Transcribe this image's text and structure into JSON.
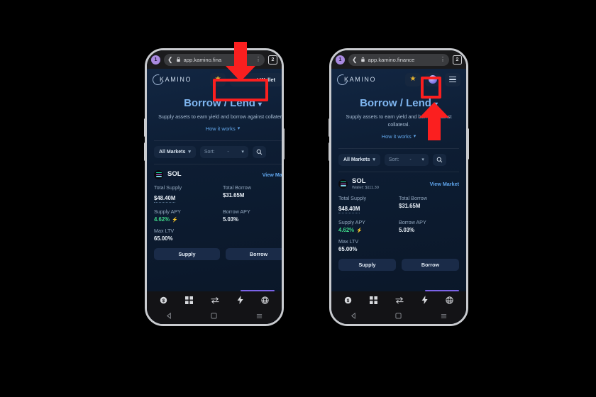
{
  "background_color": "#000000",
  "accent_highlight_color": "#fb1f1f",
  "phones": [
    {
      "id": "left",
      "state_label": "before-connect",
      "browser": {
        "profile_badge": "1",
        "back_icon": "chevron-left-icon",
        "lock_icon": "lock-icon",
        "url": "app.kamino.fina",
        "menu_icon": "kebab-menu-icon",
        "tab_count": "2"
      },
      "app": {
        "logo_text": "KAMINO",
        "header_actions": {
          "favorite_icon": "star-icon",
          "connect_wallet_label": "Connect Wallet",
          "overflow_icon": "kebab-menu-icon"
        },
        "hero": {
          "title": "Borrow / Lend",
          "title_chevron": "chevron-down-icon",
          "subtitle": "Supply assets to earn yield and borrow against collateral.",
          "how_it_works": "How it works",
          "how_chevron": "chevron-down-icon"
        },
        "filters": {
          "market_filter": "All Markets",
          "market_chevron": "chevron-down-icon",
          "sort_label": "Sort:",
          "sort_value": "-",
          "sort_chevron": "chevron-down-icon",
          "search_icon": "search-icon"
        },
        "market": {
          "symbol": "SOL",
          "wallet_line": "",
          "view_market": "View Market",
          "stats": [
            {
              "label": "Total Supply",
              "value": "$48.40M",
              "style": "dotted"
            },
            {
              "label": "Total Borrow",
              "value": "$31.65M",
              "style": "plain"
            },
            {
              "label": "Supply APY",
              "value": "4.62%",
              "style": "green",
              "badge": "lightning-icon"
            },
            {
              "label": "Borrow APY",
              "value": "5.03%",
              "style": "plain"
            },
            {
              "label": "Max LTV",
              "value": "65.00%",
              "style": "plain"
            }
          ],
          "supply_button": "Supply",
          "borrow_button": "Borrow"
        },
        "bottom_nav": [
          "dollar-circle-icon",
          "grid-icon",
          "swap-arrows-icon",
          "lightning-bolt-icon",
          "globe-icon"
        ],
        "system_nav": [
          "android-back-icon",
          "android-home-icon",
          "android-recents-icon"
        ]
      },
      "annotation": {
        "highlight_target": "connect-wallet-button",
        "arrow_direction": "down"
      }
    },
    {
      "id": "right",
      "state_label": "after-connect",
      "browser": {
        "profile_badge": "1",
        "back_icon": "chevron-left-icon",
        "lock_icon": "lock-icon",
        "url": "app.kamino.finance",
        "menu_icon": "kebab-menu-icon",
        "tab_count": "2"
      },
      "app": {
        "logo_text": "KAMINO",
        "header_actions": {
          "favorite_icon": "star-icon",
          "wallet_avatar_icon": "wallet-avatar-icon",
          "menu_icon": "hamburger-menu-icon"
        },
        "hero": {
          "title": "Borrow / Lend",
          "title_chevron": "chevron-down-icon",
          "subtitle": "Supply assets to earn yield and borrow against collateral.",
          "how_it_works": "How it works",
          "how_chevron": "chevron-down-icon"
        },
        "filters": {
          "market_filter": "All Markets",
          "market_chevron": "chevron-down-icon",
          "sort_label": "Sort:",
          "sort_value": "-",
          "sort_chevron": "chevron-down-icon",
          "search_icon": "search-icon"
        },
        "market": {
          "symbol": "SOL",
          "wallet_line": "Wallet: $111.30",
          "view_market": "View Market",
          "stats": [
            {
              "label": "Total Supply",
              "value": "$48.40M",
              "style": "dotted"
            },
            {
              "label": "Total Borrow",
              "value": "$31.65M",
              "style": "plain"
            },
            {
              "label": "Supply APY",
              "value": "4.62%",
              "style": "green",
              "badge": "lightning-icon"
            },
            {
              "label": "Borrow APY",
              "value": "5.03%",
              "style": "plain"
            },
            {
              "label": "Max LTV",
              "value": "65.00%",
              "style": "plain"
            }
          ],
          "supply_button": "Supply",
          "borrow_button": "Borrow"
        },
        "bottom_nav": [
          "dollar-circle-icon",
          "grid-icon",
          "swap-arrows-icon",
          "lightning-bolt-icon",
          "globe-icon"
        ],
        "system_nav": [
          "android-back-icon",
          "android-home-icon",
          "android-recents-icon"
        ]
      },
      "annotation": {
        "highlight_target": "wallet-avatar-button",
        "arrow_direction": "up"
      }
    }
  ]
}
